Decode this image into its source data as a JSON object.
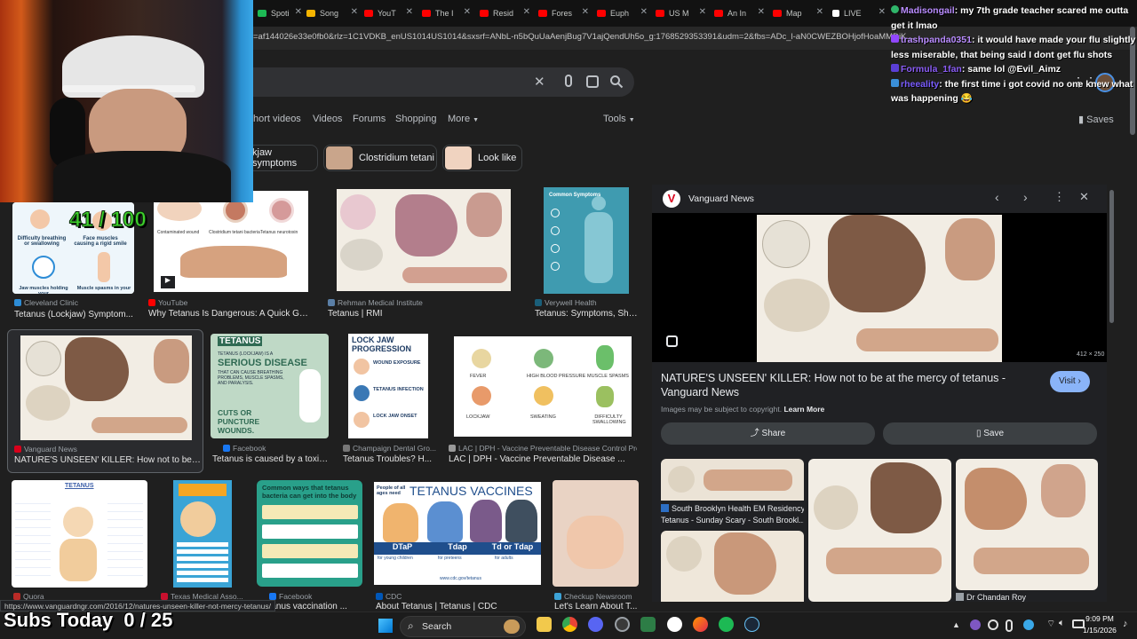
{
  "browser": {
    "tabs": [
      {
        "label": "Spoti",
        "color": "#1db954"
      },
      {
        "label": "Song",
        "color": "#f4b400"
      },
      {
        "label": "YouT",
        "color": "#ff0000"
      },
      {
        "label": "The I",
        "color": "#ff0000"
      },
      {
        "label": "Resid",
        "color": "#ff0000"
      },
      {
        "label": "Fores",
        "color": "#ff0000"
      },
      {
        "label": "Euph",
        "color": "#ff0000"
      },
      {
        "label": "US M",
        "color": "#ff0000"
      },
      {
        "label": "An In",
        "color": "#ff0000"
      },
      {
        "label": "Map",
        "color": "#ff0000"
      },
      {
        "label": "LIVE",
        "color": "#ffffff"
      }
    ],
    "url": "=af144026e33e0fb0&rlz=1C1VDKB_enUS1014US1014&sxsrf=ANbL-n5bQuUaAenjBug7V1ajQendUh5o_g:1768529353391&udm=2&fbs=ADc_l-aN0CWEZBOHjofHoaMMDiK..."
  },
  "search": {
    "value": ""
  },
  "filters": [
    "hort videos",
    "Videos",
    "Forums",
    "Shopping",
    "More",
    "Tools"
  ],
  "saves_label": "Saves",
  "chips": [
    "kjaw symptoms",
    "Clostridium tetani",
    "Look like"
  ],
  "results": [
    {
      "source": "Cleveland Clinic",
      "caption": "Tetanus (Lockjaw) Symptom...",
      "color": "#2d8cd6"
    },
    {
      "source": "YouTube",
      "caption": "Why Tetanus Is Dangerous: A Quick Guid...",
      "color": "#ff0000"
    },
    {
      "source": "Rehman Medical Institute",
      "caption": "Tetanus | RMI",
      "color": "#5b7fa6"
    },
    {
      "source": "Verywell Health",
      "caption": "Tetanus: Symptoms, Sho...",
      "color": "#1a5f7a"
    },
    {
      "source": "Vanguard News",
      "caption": "NATURE'S UNSEEN' KILLER: How not to be ...",
      "color": "#d9001b"
    },
    {
      "source": "Facebook",
      "caption": "Tetanus is caused by a toxin...",
      "color": "#1877f2"
    },
    {
      "source": "Champaign Dental Gro...",
      "caption": "Tetanus Troubles? H...",
      "color": "#777777"
    },
    {
      "source": "LAC | DPH - Vaccine Preventable Disease Control Pro...",
      "caption": "LAC | DPH - Vaccine Preventable Disease ...",
      "color": "#999999"
    },
    {
      "source": "Quora",
      "caption": "",
      "color": "#b92b27"
    },
    {
      "source": "Texas Medical Asso...",
      "caption": "",
      "color": "#c8102e"
    },
    {
      "source": "Facebook",
      "caption": "etanus vaccination ...",
      "color": "#1877f2"
    },
    {
      "source": "CDC",
      "caption": "About Tetanus | Tetanus | CDC",
      "color": "#0057b8"
    },
    {
      "source": "Checkup Newsroom",
      "caption": "Let's Learn About T...",
      "color": "#3ca2d6"
    }
  ],
  "thumb_text": {
    "difficulty": "Difficulty breathing or swallowing",
    "face_muscles": "Face muscles causing a rigid smile",
    "jaw": "Jaw muscles holding your",
    "spasms": "Muscle spasms in your",
    "contaminated": "Contaminated wound",
    "bacteria": "Clostridium tetani bacteria",
    "neurotoxin": "Tetanus neurotoxin",
    "common": "Common Symptoms",
    "tetanus_title": "TETANUS",
    "tetanus_lockjaw": "TETANUS (LOCKJAW) IS A",
    "serious": "SERIOUS DISEASE",
    "causes": "THAT CAN CAUSE BREATHING PROBLEMS, MUSCLE SPASMS, AND PARALYSIS.",
    "cuts": "CUTS OR PUNCTURE WOUNDS.",
    "lockjaw_prog": "LOCK JAW PROGRESSION",
    "wound_exposure": "WOUND EXPOSURE",
    "tetanus_infection": "TETANUS INFECTION",
    "lockjaw_onset": "LOCK JAW ONSET",
    "fever": "FEVER",
    "high_bp": "HIGH BLOOD PRESSURE",
    "muscle_spasms": "MUSCLE SPASMS",
    "lockjaw": "LOCKJAW",
    "sweating": "SWEATING",
    "diff_swallowing": "DIFFICULTY SWALLOWING",
    "quora_title": "TETANUS",
    "common_ways": "Common ways that tetanus bacteria can get into the body",
    "people_all_ages": "People of all ages need",
    "vaccines_title": "TETANUS VACCINES",
    "dtap": "DTaP",
    "tdap": "Tdap",
    "td_or_tdap": "Td or Tdap",
    "young_children": "for young children",
    "preteens": "for preteens",
    "adults": "for adults",
    "cdc_url": "www.cdc.gov/tetanus"
  },
  "panel": {
    "source": "Vanguard News",
    "title": "NATURE'S UNSEEN' KILLER: How not to be at the mercy of tetanus - Vanguard News",
    "visit": "Visit",
    "copyright": "Images may be subject to copyright.",
    "learn_more": "Learn More",
    "share": "Share",
    "save": "Save",
    "dims": "412 × 250",
    "related": [
      {
        "source": "South Brooklyn Health EM Residency",
        "caption": "Tetanus - Sunday Scary - South Brookl..."
      },
      {
        "source": "Dr Chandan Roy",
        "caption": ""
      }
    ]
  },
  "overlay": {
    "score": "41 / 100",
    "subs": "Subs Today  0 / 25",
    "hover_url": "https://www.vanguardngr.com/2016/12/natures-unseen-killer-not-mercy-tetanus/"
  },
  "chat": [
    {
      "user": "Madisongail",
      "text": ": my 7th grade teacher scared me outta get it lmao",
      "color": "#b98cff"
    },
    {
      "user": "trashpanda0351",
      "text": ": it would have made your flu slightly less miserable, that being said I dont get flu shots",
      "color": "#b98cff"
    },
    {
      "user": "Formula_1fan",
      "text": ": same lol @Evil_Aimz",
      "color": "#8a5cf5"
    },
    {
      "user": "rheeality",
      "text": ": the first time i got covid no one knew what was happening 😂",
      "color": "#7a5cff"
    }
  ],
  "taskbar": {
    "search": "Search",
    "time": "9:09 PM",
    "date": "1/15/2026"
  }
}
